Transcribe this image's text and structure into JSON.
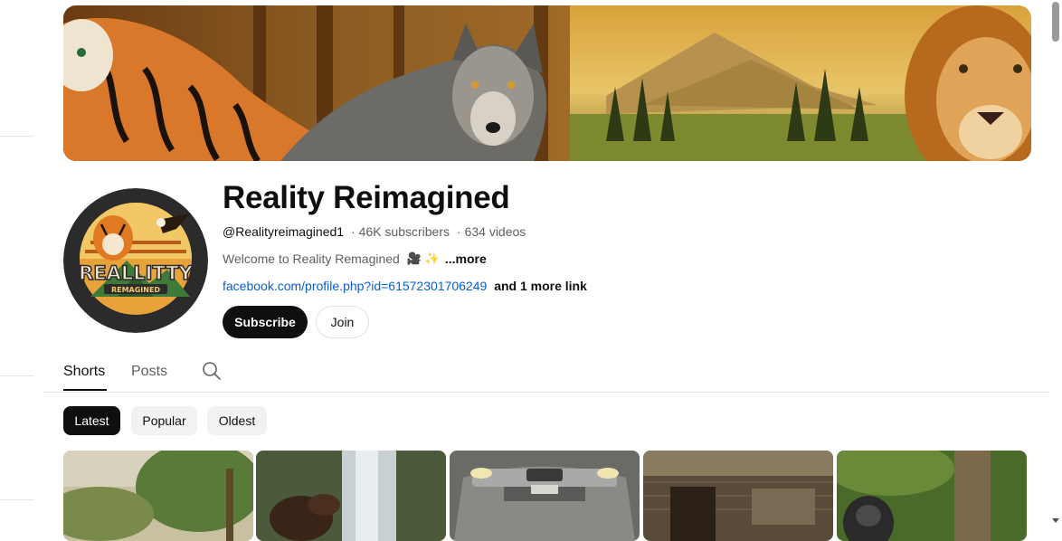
{
  "channel": {
    "name": "Reality Reimagined",
    "handle": "@Realityreimagined1",
    "separator": "·",
    "subscribers": "46K subscribers",
    "videos": "634 videos",
    "description": "Welcome to Reality Remagined",
    "description_emoji": "🎥 ✨",
    "more_label": "...more",
    "link": "facebook.com/profile.php?id=61572301706249",
    "more_links": "and 1 more link",
    "avatar_text": "REALLITTY",
    "avatar_subtext": "REMAGINED"
  },
  "actions": {
    "subscribe_label": "Subscribe",
    "join_label": "Join"
  },
  "tabs": [
    {
      "label": "Shorts",
      "active": true
    },
    {
      "label": "Posts",
      "active": false
    }
  ],
  "search_icon": "search-icon",
  "filters": [
    {
      "label": "Latest",
      "selected": true
    },
    {
      "label": "Popular",
      "selected": false
    },
    {
      "label": "Oldest",
      "selected": false
    }
  ],
  "shorts": [
    {
      "scene": "jungle-trees"
    },
    {
      "scene": "waterfall-horse"
    },
    {
      "scene": "car-front"
    },
    {
      "scene": "wooden-hut"
    },
    {
      "scene": "gorilla-forest"
    }
  ],
  "colors": {
    "text_primary": "#0f0f0f",
    "text_secondary": "#606060",
    "link": "#065fd4",
    "button_dark": "#0f0f0f",
    "chip_bg": "#f2f2f2"
  }
}
